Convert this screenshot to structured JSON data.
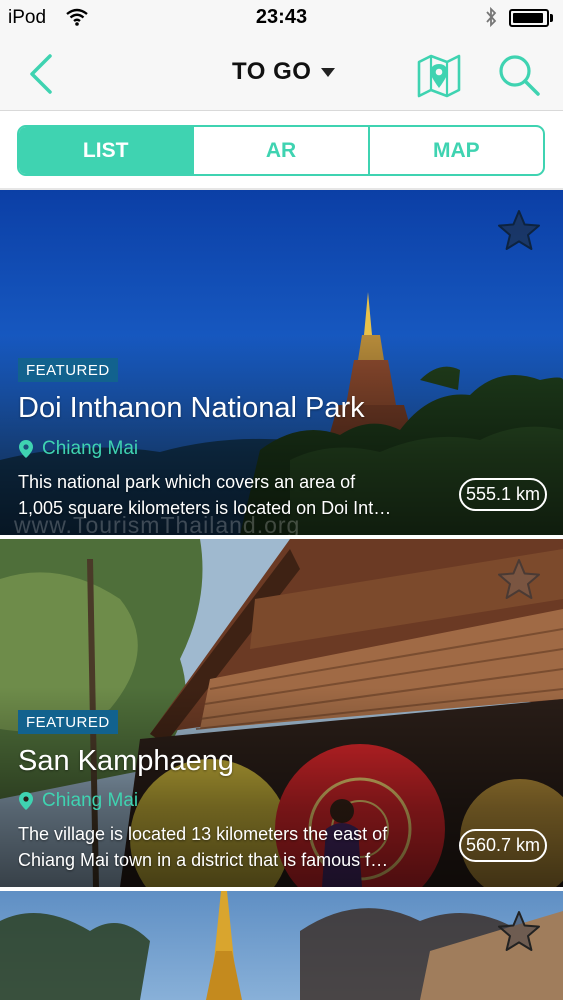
{
  "status_bar": {
    "carrier": "iPod",
    "time": "23:43",
    "battery_level": 0.95
  },
  "nav": {
    "title": "TO GO",
    "icons": [
      "back-chevron-icon",
      "map-pin-icon",
      "search-icon",
      "caret-down-icon"
    ]
  },
  "tabs": [
    {
      "label": "LIST",
      "active": true
    },
    {
      "label": "AR",
      "active": false
    },
    {
      "label": "MAP",
      "active": false
    }
  ],
  "places": [
    {
      "badge": "FEATURED",
      "title": "Doi Inthanon National Park",
      "location": "Chiang Mai",
      "desc_line1": "This national park which covers an area of",
      "desc_line2": "1,005 square kilometers is located on Doi Int…",
      "distance": "555.1 km",
      "watermark": "www.TourismThailand.org"
    },
    {
      "badge": "FEATURED",
      "title": "San Kamphaeng",
      "location": "Chiang Mai",
      "desc_line1": "The village is located 13 kilometers the east of",
      "desc_line2": "Chiang Mai town in a district that is famous f…",
      "distance": "560.7 km"
    }
  ],
  "colors": {
    "accent": "#3fd3b1",
    "badge": "#12628e",
    "bar": "#f7f7f7"
  }
}
